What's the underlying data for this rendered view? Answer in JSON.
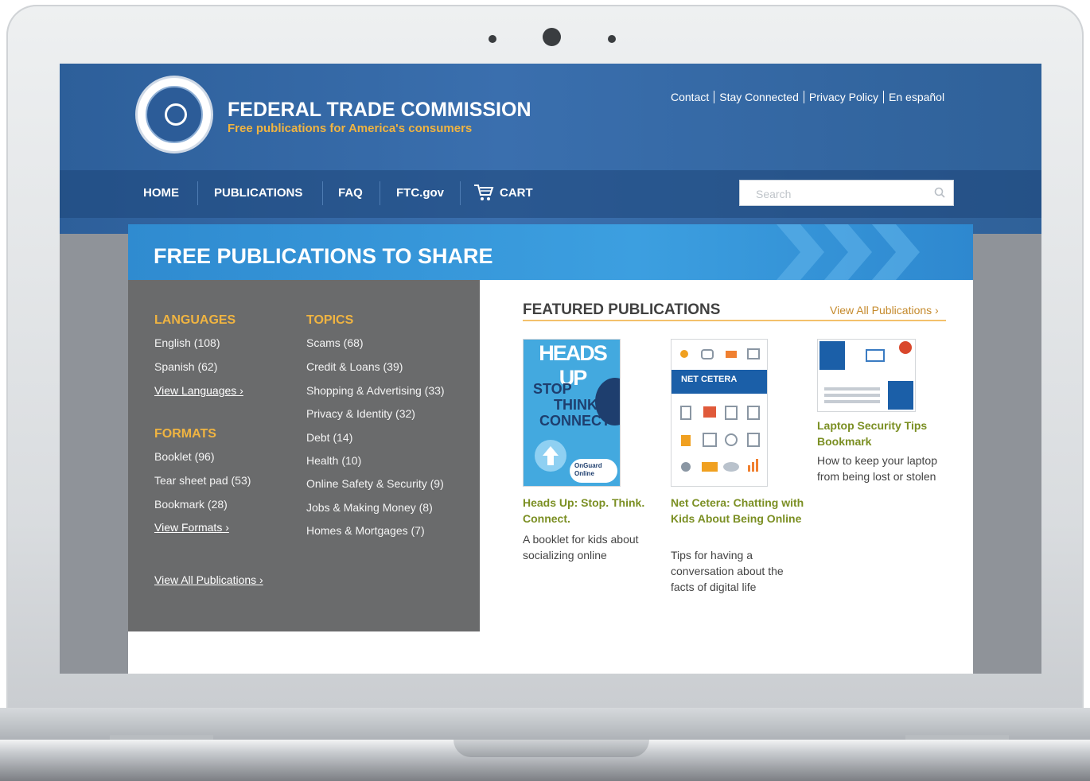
{
  "site": {
    "title": "FEDERAL TRADE COMMISSION",
    "subtitle": "Free publications for America's consumers"
  },
  "utility_links": [
    "Contact",
    "Stay Connected",
    "Privacy Policy",
    "En español"
  ],
  "nav": {
    "home": "HOME",
    "publications": "PUBLICATIONS",
    "faq": "FAQ",
    "ftc": "FTC.gov",
    "cart": "CART"
  },
  "search": {
    "placeholder": "Search"
  },
  "banner": {
    "title": "FREE PUBLICATIONS TO SHARE"
  },
  "sidebar": {
    "languages": {
      "heading": "LANGUAGES",
      "items": [
        "English (108)",
        "Spanish (62)"
      ],
      "link": "View Languages ›"
    },
    "formats": {
      "heading": "FORMATS",
      "items": [
        "Booklet (96)",
        "Tear sheet pad (53)",
        "Bookmark (28)"
      ],
      "link": "View Formats ›"
    },
    "topics": {
      "heading": "TOPICS",
      "items": [
        "Scams (68)",
        "Credit & Loans (39)",
        "Shopping & Advertising (33)",
        "Privacy & Identity (32)",
        "Debt (14)",
        "Health (10)",
        "Online Safety & Security (9)",
        "Jobs & Making Money (8)",
        "Homes & Mortgages (7)"
      ]
    },
    "view_all": "View All Publications ›"
  },
  "featured": {
    "heading": "FEATURED PUBLICATIONS",
    "view_all": "View All Publications ›",
    "items": [
      {
        "title": "Heads Up: Stop. Think. Connect.",
        "desc": "A booklet for kids about socializing online",
        "cover_text": [
          "HEADS UP",
          "STOP",
          "THINK",
          "CONNECT",
          "OnGuard Online"
        ]
      },
      {
        "title": "Net Cetera: Chatting with Kids About Being Online",
        "desc": "Tips for having a conversation about the facts of digital life",
        "cover_text": [
          "NET CETERA"
        ]
      },
      {
        "title": "Laptop Security Tips Bookmark",
        "desc": "How to keep your laptop from being lost or stolen",
        "cover_text": []
      }
    ]
  },
  "colors": {
    "header_blue": "#2f6199",
    "banner_blue": "#3c9fe0",
    "accent_orange": "#f0b441",
    "link_green": "#7b8f23",
    "sidebar_gray": "#6a6b6c"
  }
}
